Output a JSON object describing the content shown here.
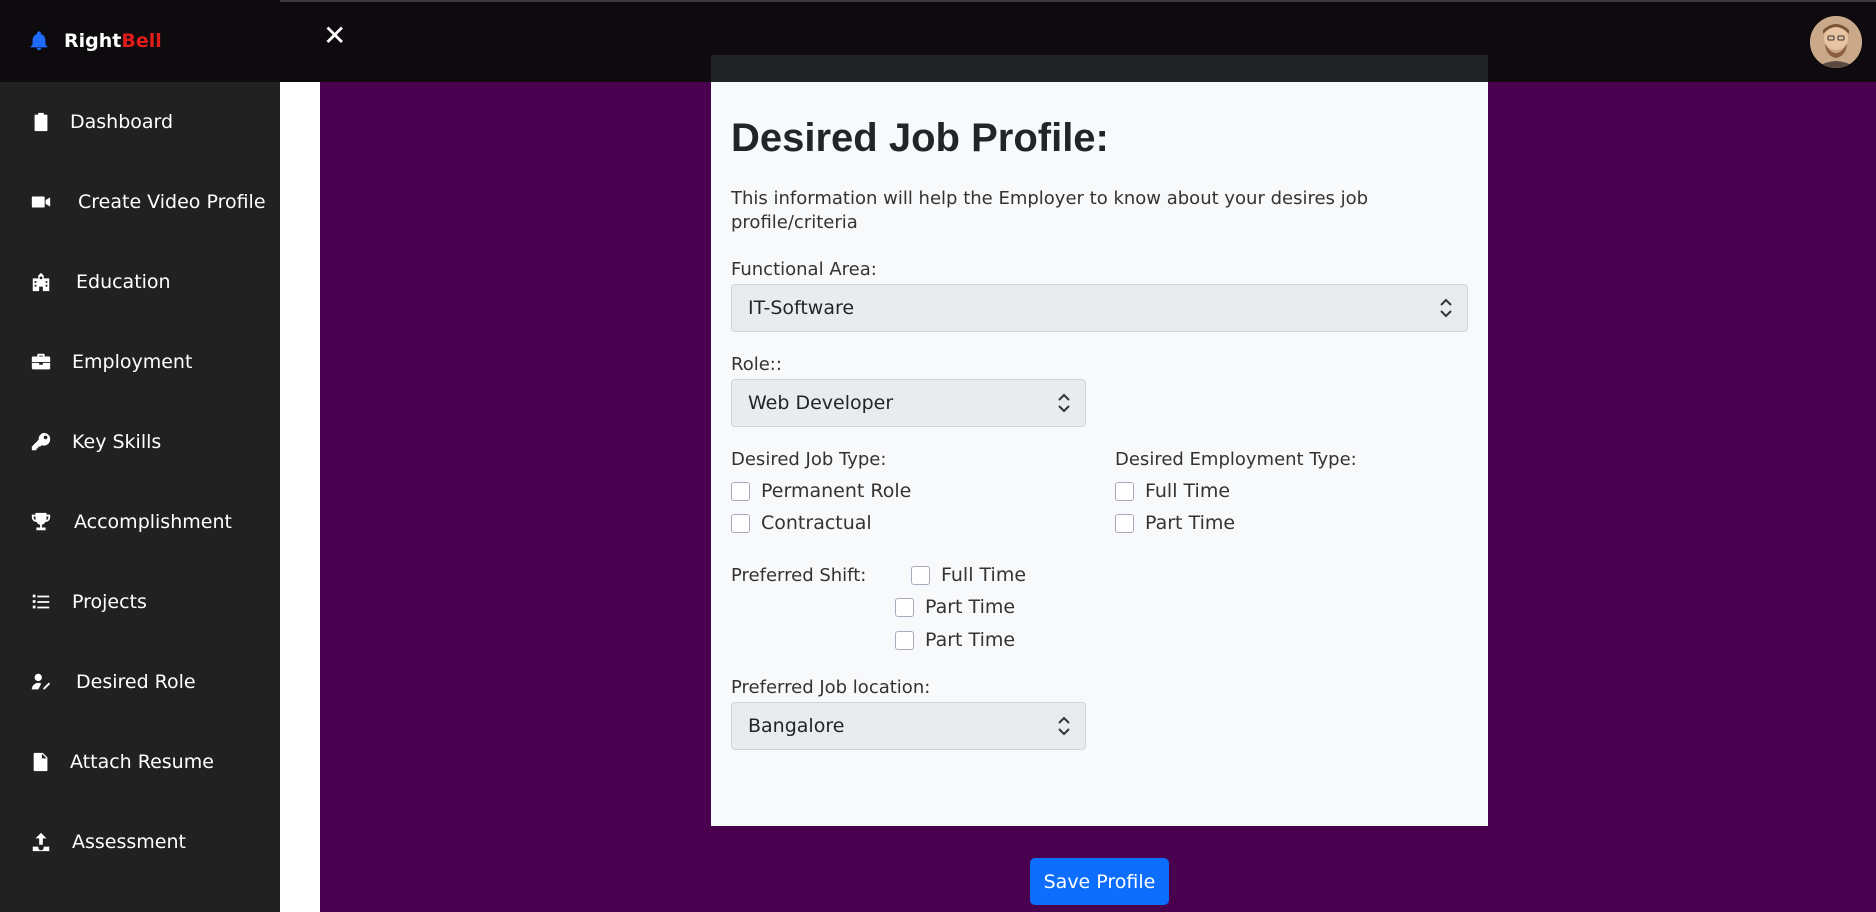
{
  "brand": {
    "right": "Right",
    "bell": "Bell"
  },
  "sidebar": {
    "items": [
      {
        "label": "Dashboard",
        "icon": "clipboard-icon"
      },
      {
        "label": "Create Video Profile",
        "icon": "video-camera-icon"
      },
      {
        "label": "Education",
        "icon": "school-icon"
      },
      {
        "label": "Employment",
        "icon": "briefcase-icon"
      },
      {
        "label": "Key Skills",
        "icon": "key-icon"
      },
      {
        "label": "Accomplishment",
        "icon": "trophy-icon"
      },
      {
        "label": "Projects",
        "icon": "task-list-icon"
      },
      {
        "label": "Desired Role",
        "icon": "user-edit-icon"
      },
      {
        "label": "Attach Resume",
        "icon": "file-icon"
      },
      {
        "label": "Assessment",
        "icon": "upload-icon"
      }
    ]
  },
  "topbar": {
    "close": "✕"
  },
  "form": {
    "title": "Desired Job Profile:",
    "description": "This information will help the Employer to know about your desires job profile/criteria",
    "functional_area": {
      "label": "Functional Area:",
      "value": "IT-Software"
    },
    "role": {
      "label": "Role::",
      "value": "Web Developer"
    },
    "job_type": {
      "label": "Desired Job Type:",
      "options": [
        "Permanent Role",
        "Contractual"
      ]
    },
    "employment_type": {
      "label": "Desired Employment Type:",
      "options": [
        "Full Time",
        "Part Time"
      ]
    },
    "shift": {
      "label": "Preferred Shift:",
      "options": [
        "Full Time",
        "Part Time",
        "Part Time"
      ]
    },
    "location": {
      "label": "Preferred Job location:",
      "value": "Bangalore"
    }
  },
  "save_button": "Save Profile",
  "colors": {
    "sidebar": "#212121",
    "purple": "#48004f",
    "accent": "#0d6efd",
    "brand_red": "#e21b1b"
  }
}
